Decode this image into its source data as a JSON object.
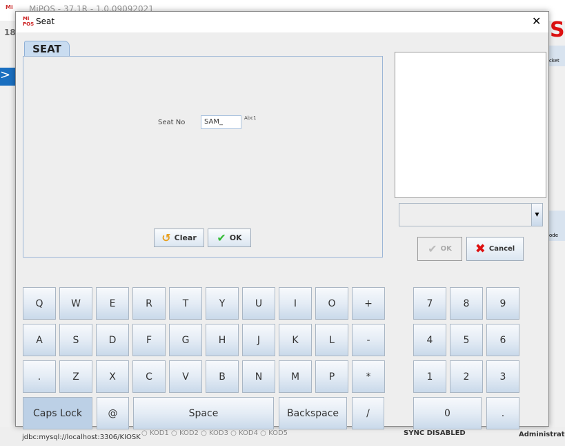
{
  "background": {
    "app_title": "MiPOS - 37.1R - 1.0.09092021",
    "left_text": "18",
    "brand_letter": "S",
    "db": "jdbc:mysql://localhost:3306/KIOSK",
    "radios": [
      "KOD1",
      "KOD2",
      "KOD3",
      "KOD4",
      "KOD5"
    ],
    "sync": "SYNC DISABLED",
    "user": "Administrator",
    "side_labels": [
      "cket",
      "ode"
    ]
  },
  "dialog": {
    "title": "Seat",
    "logo": "MiPOS",
    "close": "✕"
  },
  "tab": {
    "label": "SEAT"
  },
  "form": {
    "seat_label": "Seat No",
    "seat_value": "SAM_",
    "input_mode": "Abc1"
  },
  "buttons": {
    "clear": "Clear",
    "ok": "OK",
    "ok2": "OK",
    "cancel": "Cancel"
  },
  "keyboard": {
    "rows": [
      [
        "Q",
        "W",
        "E",
        "R",
        "T",
        "Y",
        "U",
        "I",
        "O",
        "+"
      ],
      [
        "A",
        "S",
        "D",
        "F",
        "G",
        "H",
        "J",
        "K",
        "L",
        "-"
      ],
      [
        ".",
        "Z",
        "X",
        "C",
        "V",
        "B",
        "N",
        "M",
        "P",
        "*"
      ]
    ],
    "bottom": [
      "Caps Lock",
      "@",
      "Space",
      "Backspace",
      "/"
    ],
    "numpad": [
      [
        "7",
        "8",
        "9"
      ],
      [
        "4",
        "5",
        "6"
      ],
      [
        "1",
        "2",
        "3"
      ]
    ],
    "numpad_bottom": [
      "0",
      "."
    ]
  },
  "colors": {
    "key_top": "#f7f9fc",
    "key_bottom": "#c9d9ea",
    "caps_active": "#bcd0e6",
    "cancel_icon": "#d11",
    "ok_icon": "#3b3"
  }
}
